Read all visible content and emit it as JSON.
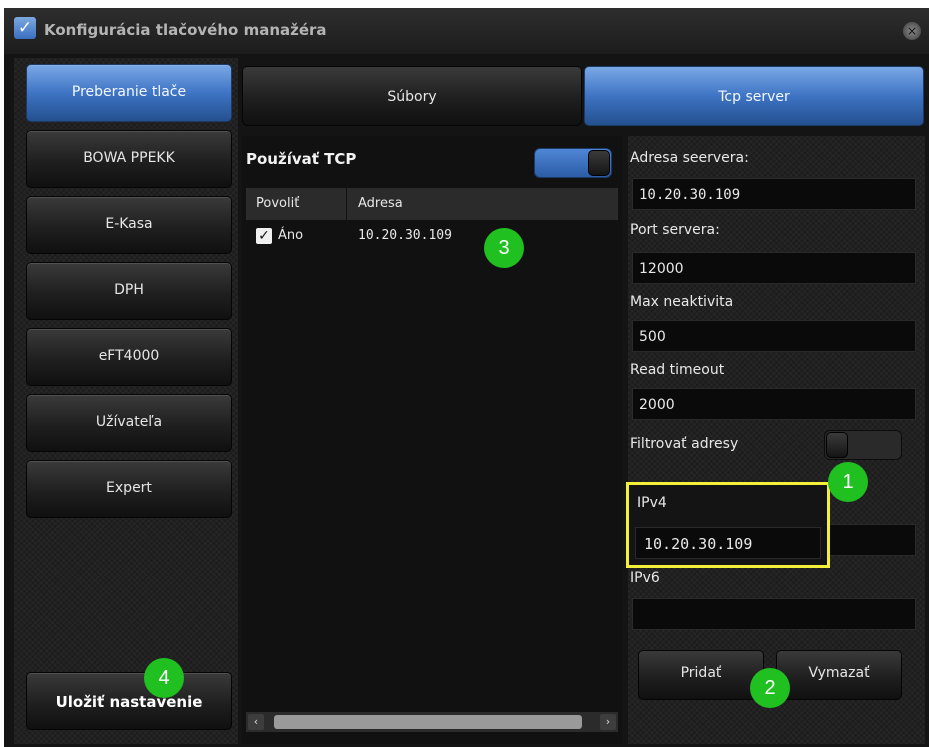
{
  "window": {
    "title": "Konfigurácia tlačového manažéra",
    "close_glyph": "×",
    "app_icon": "check-icon"
  },
  "sidebar": {
    "items": [
      {
        "label": "Preberanie tlače",
        "active": true
      },
      {
        "label": "BOWA PPEKK",
        "active": false
      },
      {
        "label": "E-Kasa",
        "active": false
      },
      {
        "label": "DPH",
        "active": false
      },
      {
        "label": "eFT4000",
        "active": false
      },
      {
        "label": "Užívateľa",
        "active": false
      },
      {
        "label": "Expert",
        "active": false
      }
    ],
    "save_label": "Uložiť nastavenie"
  },
  "tabs": [
    {
      "label": "Súbory",
      "active": false
    },
    {
      "label": "Tcp server",
      "active": true
    }
  ],
  "tcp": {
    "use_label": "Používať TCP",
    "use_enabled": true,
    "columns": [
      "Povoliť",
      "Adresa"
    ],
    "rows": [
      {
        "enabled": "Áno",
        "address": "10.20.30.109"
      }
    ],
    "check_glyph": "✓",
    "scroll_left": "‹",
    "scroll_right": "›"
  },
  "server": {
    "address_label": "Adresa seervera:",
    "address_value": "10.20.30.109",
    "port_label": "Port servera:",
    "port_value": "12000",
    "inactivity_label": "Max neaktivita",
    "inactivity_value": "500",
    "timeout_label": "Read timeout",
    "timeout_value": "2000",
    "filter_label": "Filtrovať adresy",
    "filter_enabled": false,
    "ipv4_label": "IPv4",
    "ipv4_value": "10.20.30.109",
    "ipv6_label": "IPv6",
    "ipv6_value": "",
    "add_label": "Pridať",
    "delete_label": "Vymazať"
  },
  "annotations": [
    "1",
    "2",
    "3",
    "4"
  ],
  "colors": {
    "accent": "#3e74c4",
    "highlight": "#f4ef3a",
    "badge": "#20c020"
  }
}
